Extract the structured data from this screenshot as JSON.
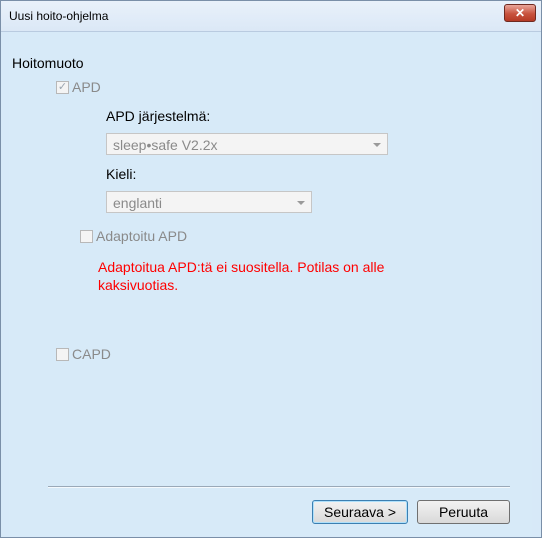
{
  "window": {
    "title": "Uusi hoito-ohjelma",
    "close_glyph": "✕"
  },
  "treatment": {
    "section_label": "Hoitomuoto",
    "apd": {
      "label": "APD",
      "checked": true,
      "enabled": false
    },
    "apd_system": {
      "label": "APD järjestelmä:",
      "value": "sleep•safe V2.2x"
    },
    "language": {
      "label": "Kieli:",
      "value": "englanti"
    },
    "adapted_apd": {
      "label": "Adaptoitu APD",
      "checked": false,
      "enabled": false
    },
    "warning": "Adaptoitua APD:tä ei suositella. Potilas on alle kaksivuotias.",
    "capd": {
      "label": "CAPD",
      "checked": false,
      "enabled": false
    }
  },
  "buttons": {
    "next": "Seuraava >",
    "cancel": "Peruuta"
  },
  "colors": {
    "background": "#d7eaf8",
    "warning": "#ff0000",
    "disabled_text": "#8a8a8a"
  }
}
